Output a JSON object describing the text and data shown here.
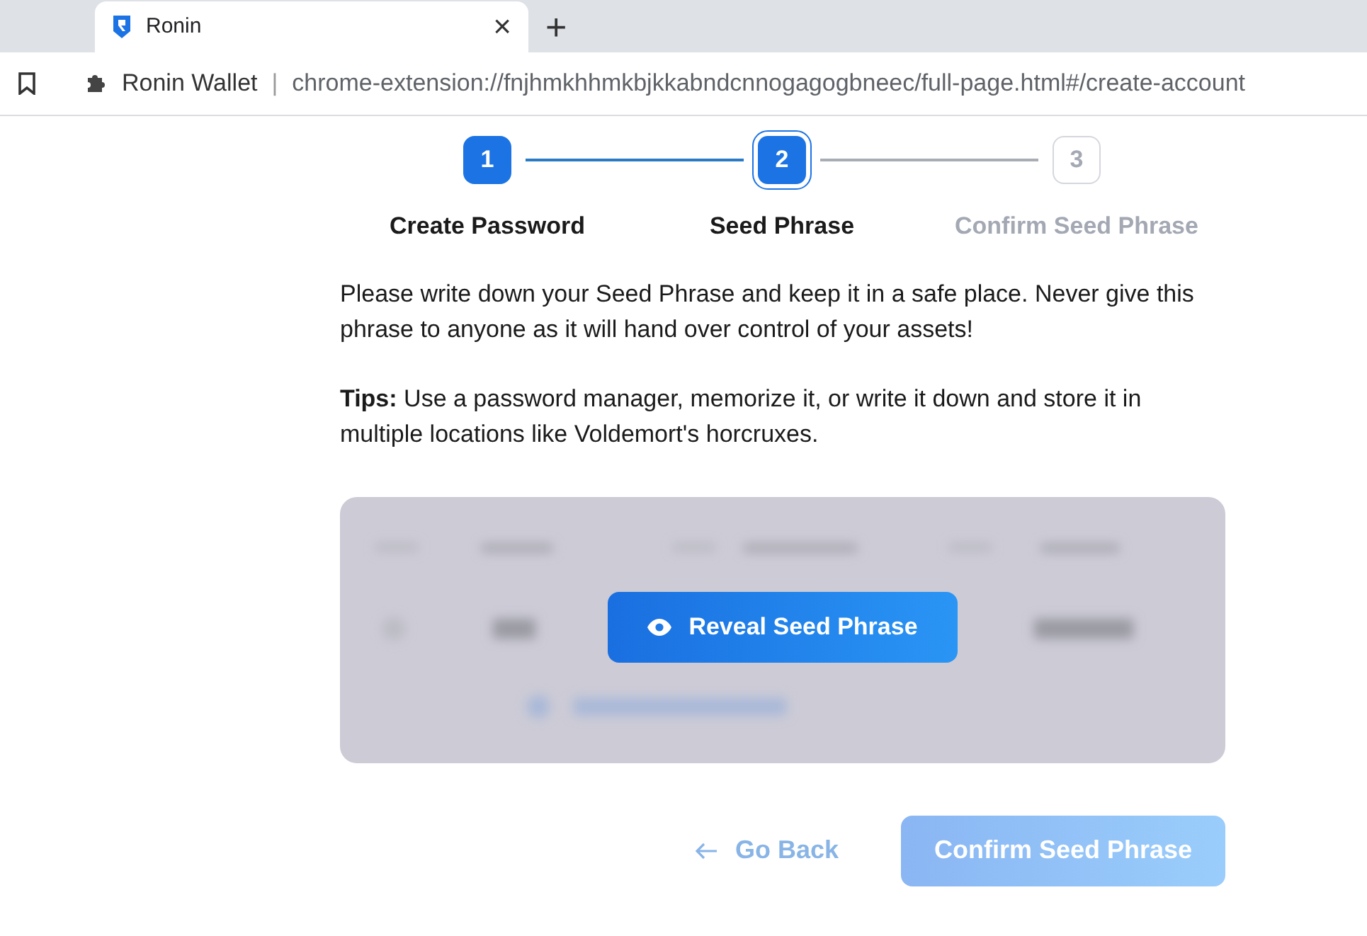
{
  "browser": {
    "tab": {
      "title": "Ronin",
      "close": "×",
      "new_tab": "+"
    },
    "address_bar": {
      "site": "Ronin Wallet",
      "separator": "|",
      "url": "chrome-extension://fnjhmkhhmkbjkkabndcnnogagogbneec/full-page.html#/create-account"
    }
  },
  "steps": [
    {
      "number": "1",
      "label": "Create Password",
      "completed": true,
      "selected": false
    },
    {
      "number": "2",
      "label": "Seed Phrase",
      "completed": false,
      "selected": true
    },
    {
      "number": "3",
      "label": "Confirm Seed Phrase",
      "completed": false,
      "selected": false
    }
  ],
  "instructions": "Please write down your Seed Phrase and keep it in a safe place. Never give this phrase to anyone as it will hand over control of your assets!",
  "tips": "**Tips:** Use a password manager, memorize it, or write it down and store it in multiple locations like Voldemort's horcruxes.",
  "seed_panel": {
    "reveal_button": "Reveal Seed Phrase"
  },
  "footer": {
    "back": "Go Back",
    "confirm": {
      "label": "Confirm Seed Phrase",
      "disabled": true
    }
  }
}
